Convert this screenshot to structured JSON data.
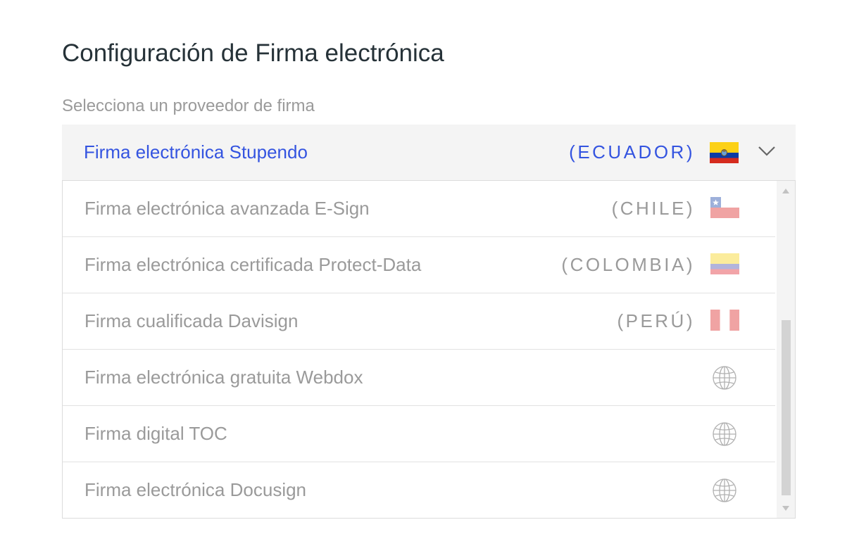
{
  "page": {
    "title": "Configuración de Firma electrónica",
    "subtitle": "Selecciona un proveedor de firma"
  },
  "select": {
    "label": "Firma electrónica Stupendo",
    "country": "(ECUADOR)",
    "flag_icon": "ecuador-flag-icon",
    "accent_color": "#3454e0"
  },
  "options": [
    {
      "label": "Firma electrónica avanzada E-Sign",
      "country": "(CHILE)",
      "icon": "chile-flag-icon"
    },
    {
      "label": "Firma electrónica certificada Protect-Data",
      "country": "(COLOMBIA)",
      "icon": "colombia-flag-icon"
    },
    {
      "label": "Firma cualificada Davisign",
      "country": "(PERÚ)",
      "icon": "peru-flag-icon"
    },
    {
      "label": "Firma electrónica gratuita Webdox",
      "country": "",
      "icon": "globe-icon"
    },
    {
      "label": "Firma digital TOC",
      "country": "",
      "icon": "globe-icon"
    },
    {
      "label": "Firma electrónica Docusign",
      "country": "",
      "icon": "globe-icon"
    }
  ]
}
